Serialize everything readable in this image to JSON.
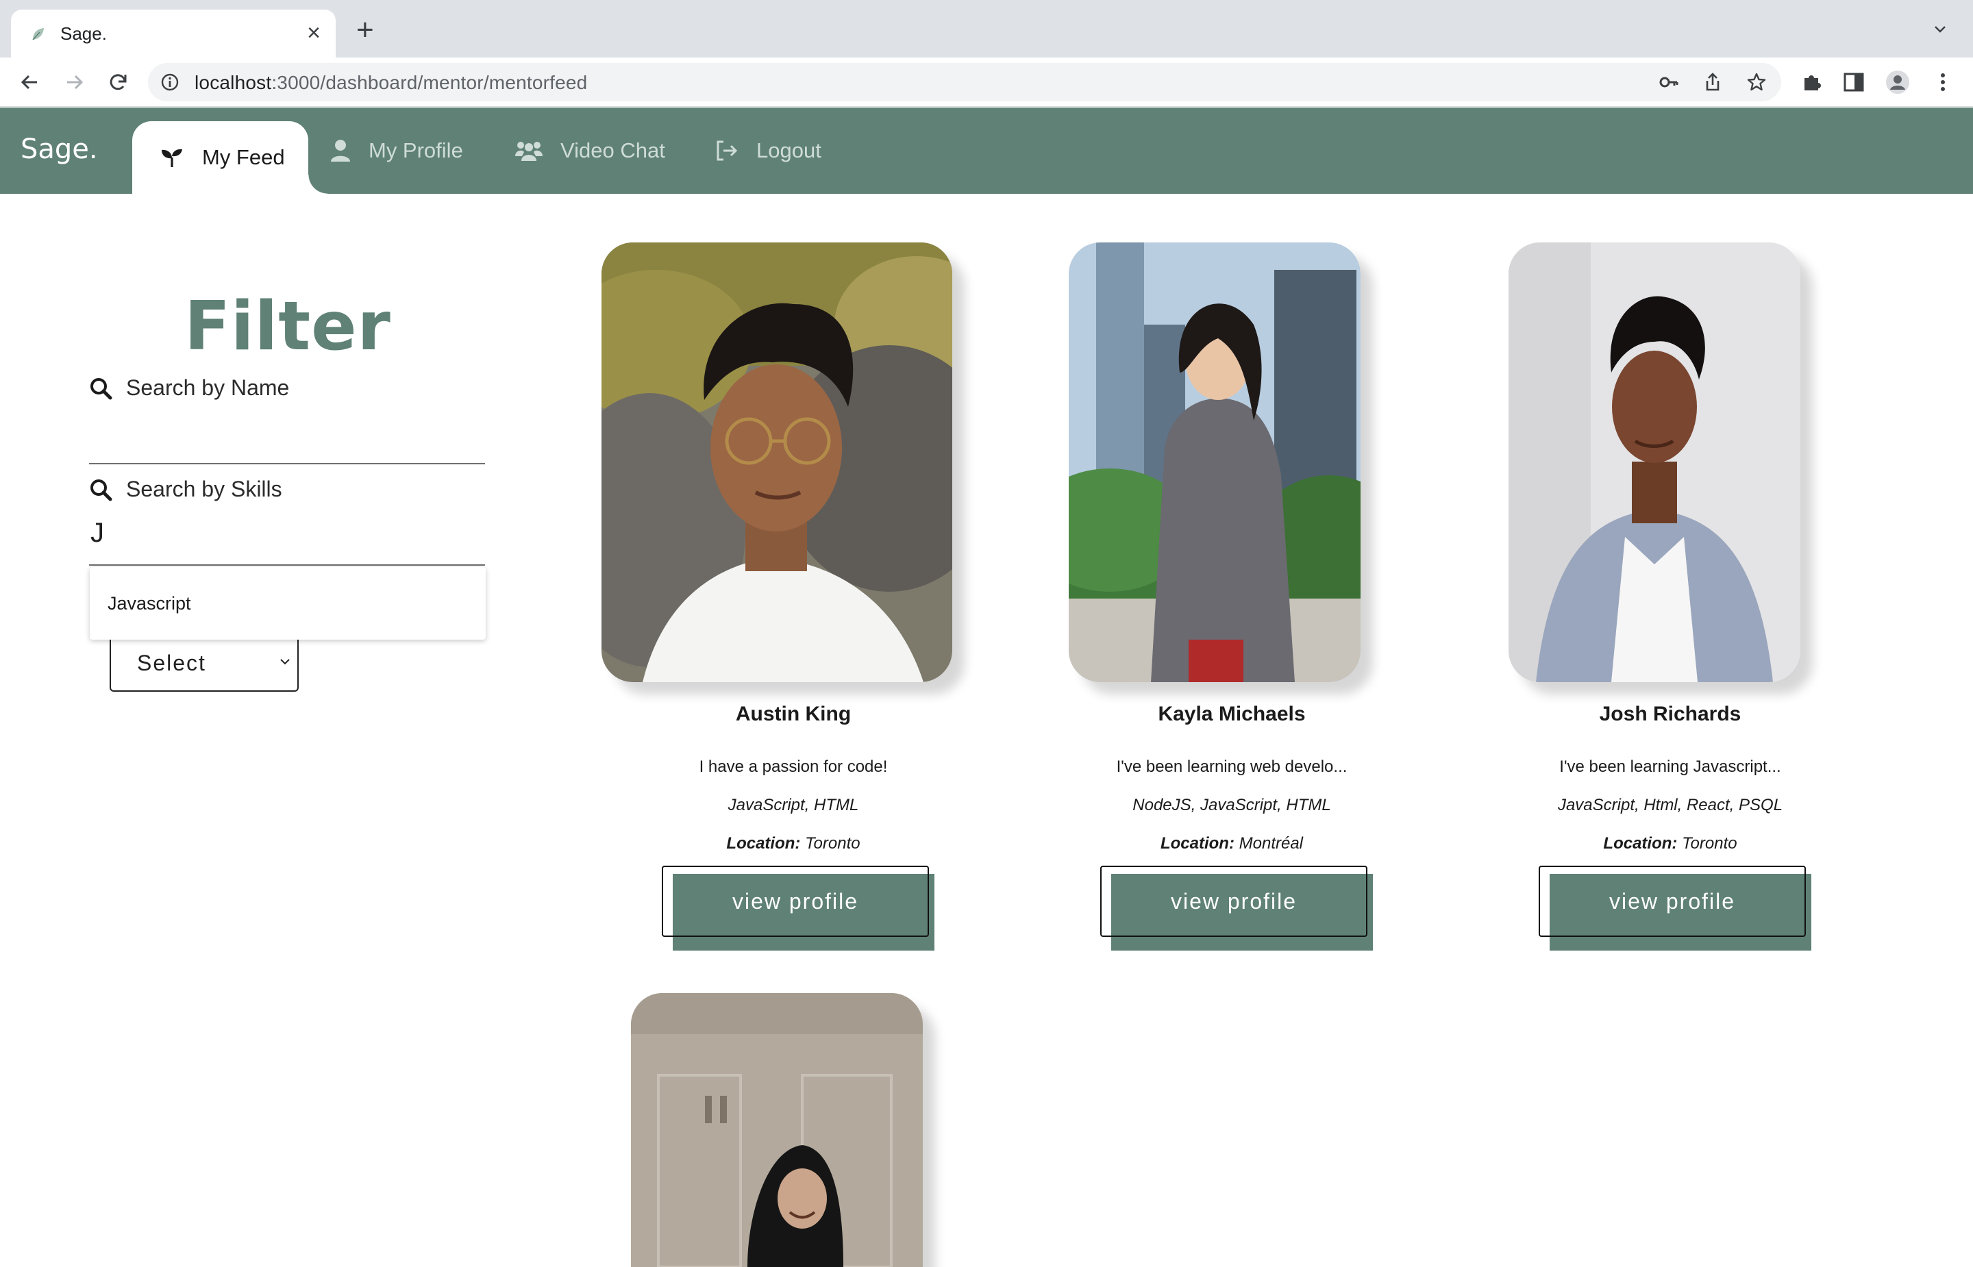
{
  "browser": {
    "tab_title": "Sage.",
    "url_host": "localhost",
    "url_path": ":3000/dashboard/mentor/mentorfeed"
  },
  "app": {
    "brand": "Sage.",
    "nav": [
      {
        "label": "My Feed",
        "icon": "sprout-icon",
        "active": true
      },
      {
        "label": "My Profile",
        "icon": "user-icon"
      },
      {
        "label": "Video Chat",
        "icon": "users-icon"
      },
      {
        "label": "Logout",
        "icon": "logout-icon"
      }
    ],
    "accent_color": "#5f8176"
  },
  "filter": {
    "title": "Filter",
    "search_name_label": "Search by Name",
    "search_name_value": "",
    "search_skills_label": "Search by Skills",
    "search_skills_value": "J",
    "suggestions": [
      "Javascript"
    ],
    "select_value": "Select"
  },
  "mentors": [
    {
      "name": "Austin King",
      "bio": "I have a passion for code!",
      "skills": "JavaScript, HTML",
      "location_label": "Location:",
      "location": "Toronto",
      "button": "view profile"
    },
    {
      "name": "Kayla Michaels",
      "bio": "I've been learning web develo...",
      "skills": "NodeJS, JavaScript, HTML",
      "location_label": "Location:",
      "location": "Montréal",
      "button": "view profile"
    },
    {
      "name": "Josh Richards",
      "bio": "I've been learning Javascript...",
      "skills": "JavaScript, Html, React, PSQL",
      "location_label": "Location:",
      "location": "Toronto",
      "button": "view profile"
    }
  ]
}
